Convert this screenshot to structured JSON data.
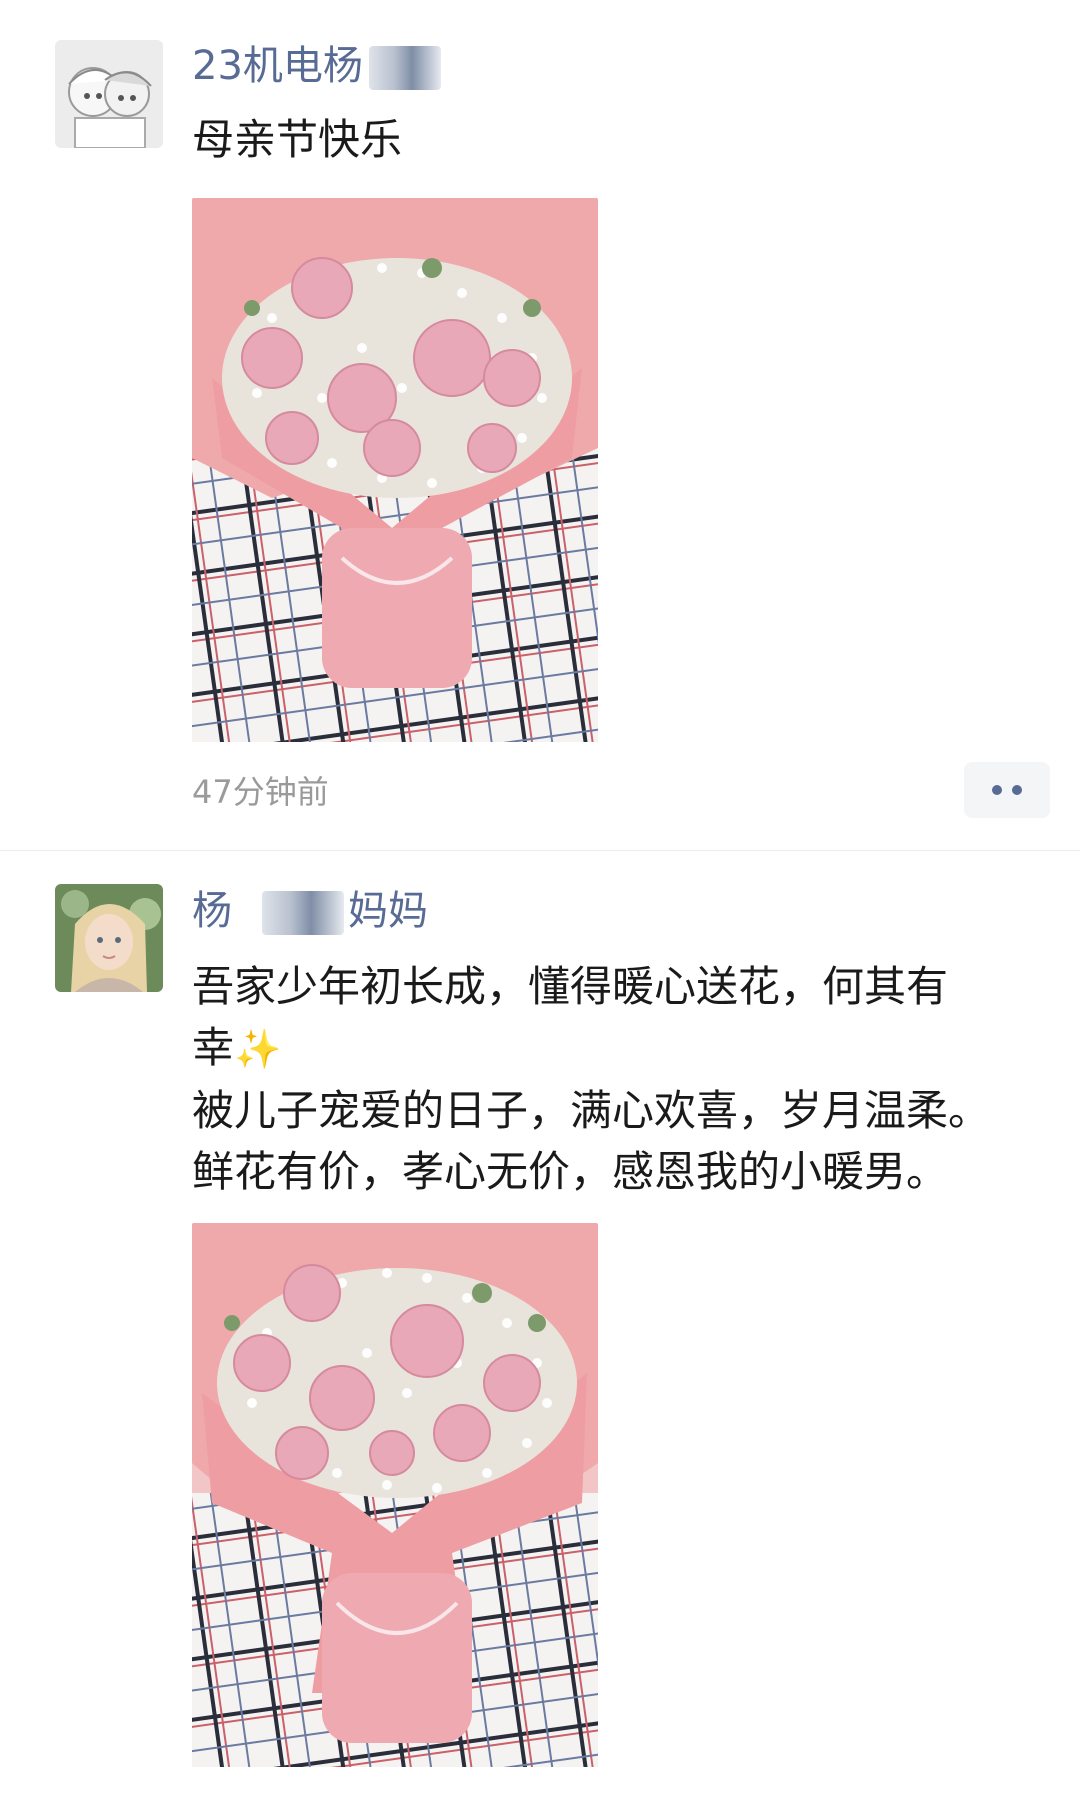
{
  "posts": [
    {
      "nickname": "23机电杨",
      "text_lines": [
        "母亲节快乐"
      ],
      "time": "47分钟前"
    },
    {
      "nickname_prefix": "杨",
      "nickname_suffix": "妈妈",
      "text_lines": [
        "吾家少年初长成，懂得暖心送花，何其有",
        "幸",
        "被儿子宠爱的日子，满心欢喜，岁月温柔。",
        "鲜花有价，孝心无价，感恩我的小暖男。"
      ],
      "sparkle_icon": "sparkles-icon"
    }
  ],
  "colors": {
    "nickname": "#576b95",
    "time": "#9a9a9a",
    "wrap_pink": "#f2a8a8",
    "carnation": "#e8a8b8"
  }
}
